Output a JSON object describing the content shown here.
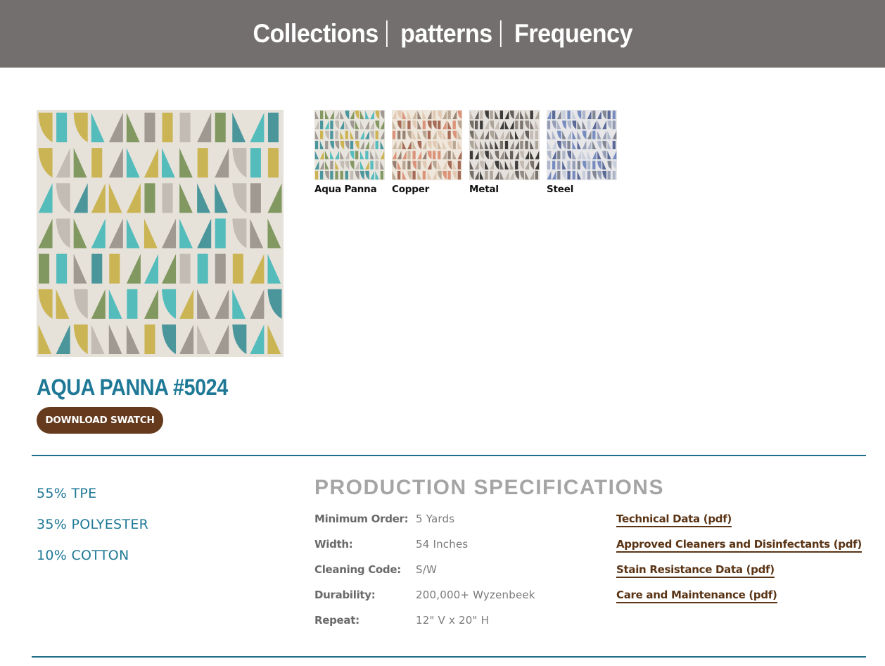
{
  "breadcrumb": {
    "items": [
      "Collections",
      "patterns",
      "Frequency"
    ]
  },
  "colorways": [
    {
      "label": "Aqua Panna",
      "palette": [
        "#49b8ba",
        "#7a9157",
        "#c9b049",
        "#9a938c",
        "#bfb9b1",
        "#3d8f96"
      ]
    },
    {
      "label": "Copper",
      "palette": [
        "#d98c70",
        "#c8b49a",
        "#8e7a68",
        "#b3a08b",
        "#e0c7b0",
        "#a0614a"
      ]
    },
    {
      "label": "Metal",
      "palette": [
        "#5b5550",
        "#8c837b",
        "#2f2d2b",
        "#a79d93",
        "#6f6760",
        "#c0b6ac"
      ]
    },
    {
      "label": "Steel",
      "palette": [
        "#6f86bb",
        "#8e98b0",
        "#4f5f8f",
        "#a9b2c6",
        "#7a7f8c",
        "#c5ccd9"
      ]
    }
  ],
  "product": {
    "title": "AQUA PANNA #5024",
    "download_label": "DOWNLOAD SWATCH"
  },
  "content": [
    "55% TPE",
    "35% POLYESTER",
    "10% COTTON"
  ],
  "specs": {
    "title": "PRODUCTION SPECIFICATIONS",
    "rows": [
      {
        "label": "Minimum Order:",
        "value": "5 Yards"
      },
      {
        "label": "Width:",
        "value": "54 Inches"
      },
      {
        "label": "Cleaning Code:",
        "value": "S/W"
      },
      {
        "label": "Durability:",
        "value": "200,000+ Wyzenbeek"
      },
      {
        "label": "Repeat:",
        "value": "12\" V x 20\" H"
      }
    ]
  },
  "documents": [
    "Technical Data (pdf)",
    "Approved Cleaners and Disinfectants (pdf)",
    "Stain Resistance Data (pdf)",
    "Care and Maintenance (pdf)"
  ]
}
